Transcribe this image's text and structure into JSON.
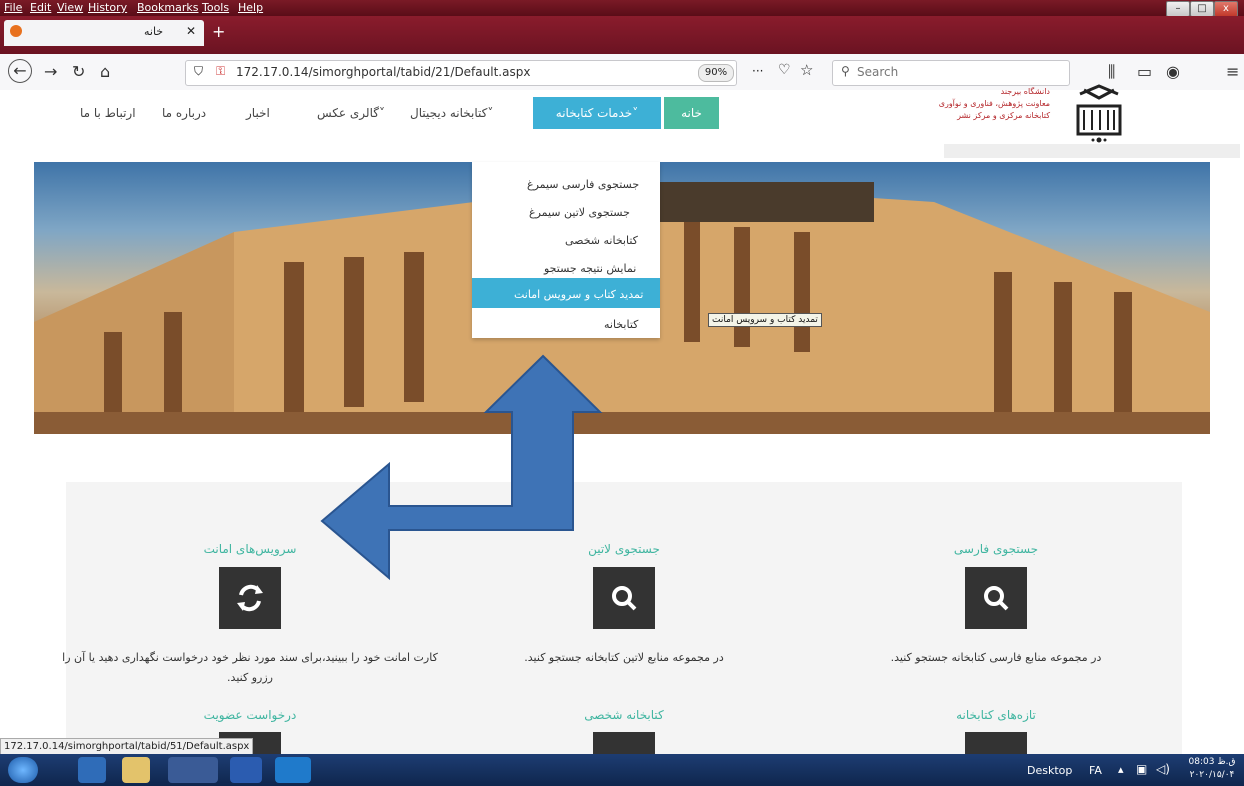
{
  "menu": [
    "File",
    "Edit",
    "View",
    "History",
    "Bookmarks",
    "Tools",
    "Help"
  ],
  "tab": {
    "title": "خانه",
    "close": "✕",
    "new": "+"
  },
  "toolbar": {
    "url": "172.17.0.14/simorghportal/tabid/21/Default.aspx",
    "zoom": "90%",
    "search_placeholder": "Search",
    "more": "···"
  },
  "nav": {
    "home": "خانه",
    "services": "خدمات کتابخانه",
    "digital": "کتابخانه دیجیتال",
    "gallery": "گالری عکس",
    "news": "اخبار",
    "about": "درباره ما",
    "contact": "ارتباط با ما"
  },
  "university": {
    "line1": "دانشگاه بیرجند",
    "line2": "معاونت پژوهش، فناوری و نوآوری",
    "line3": "کتابخانه مرکزی و مرکز نشر"
  },
  "dropdown": {
    "items": [
      "جستجوی فارسی سیمرغ",
      "جستجوی لاتین سیمرغ",
      "کتابخانه شخصی",
      "نمایش نتیجه جستجو",
      "تمدید کتاب و سرویس امانت",
      "کتابخانه"
    ],
    "tooltip": "تمدید کتاب و سرویس امانت"
  },
  "services": [
    {
      "title": "سرویس‌های امانت",
      "icon": "refresh-icon",
      "desc": "کارت امانت خود را ببینید،برای سند مورد نظر خود درخواست نگهداری دهید یا آن را رزرو کنید."
    },
    {
      "title": "جستجوی لاتین",
      "icon": "search-icon",
      "desc": "در مجموعه منابع لاتین کتابخانه جستجو کنید."
    },
    {
      "title": "جستجوی فارسی",
      "icon": "search-icon",
      "desc": "در مجموعه منابع فارسی کتابخانه جستجو کنید."
    }
  ],
  "services_row2": [
    "درخواست عضویت",
    "کتابخانه شخصی",
    "تازه‌های کتابخانه"
  ],
  "status_url": "172.17.0.14/simorghportal/tabid/51/Default.aspx",
  "taskbar": {
    "desktop": "Desktop",
    "lang": "FA",
    "time": "08:03 ق.ظ",
    "date": "۲۰۲۰/۱۵/۰۴"
  },
  "colors": {
    "accent_teal": "#4dbb9e",
    "accent_blue": "#3db0d6",
    "arrow": "#3e73b6"
  }
}
